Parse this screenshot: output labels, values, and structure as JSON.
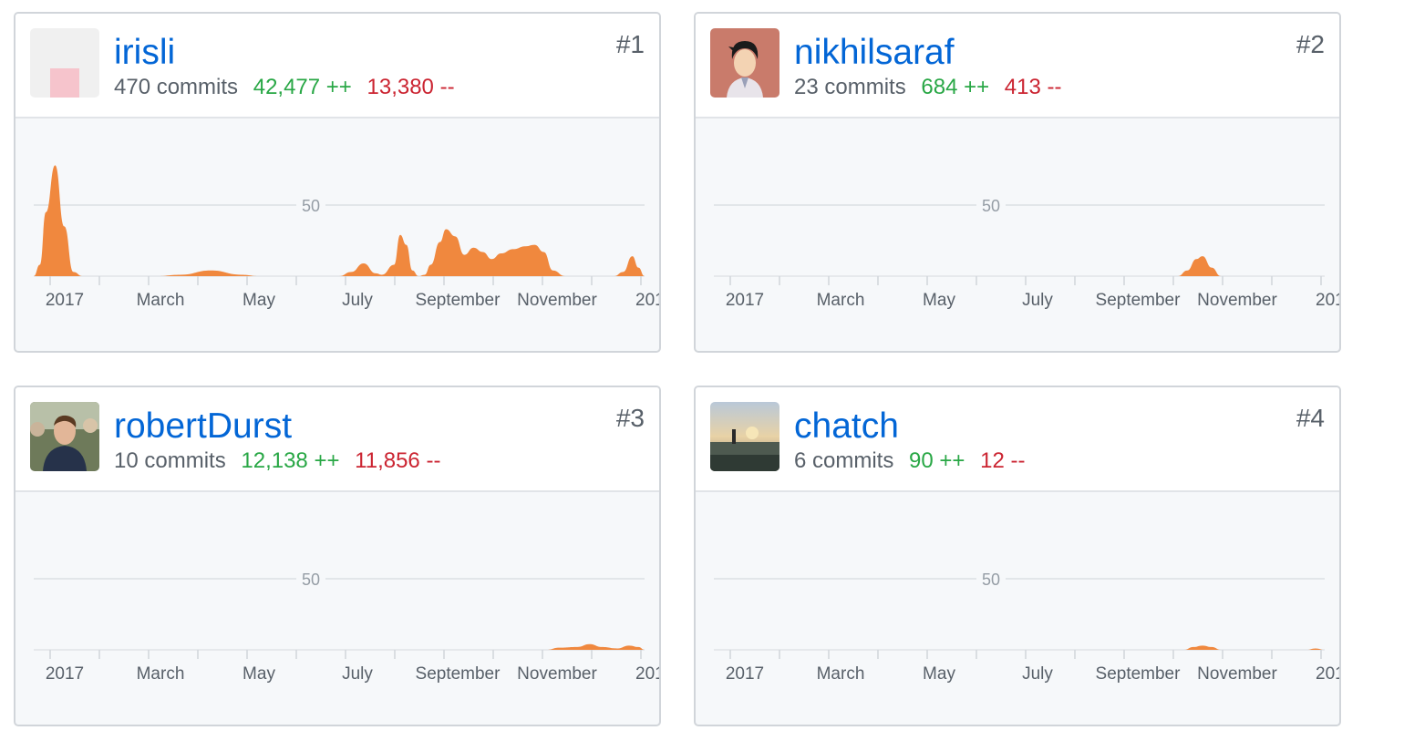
{
  "contributors": [
    {
      "rank": "#1",
      "username": "irisli",
      "commits": "470 commits",
      "additions": "42,477 ++",
      "deletions": "13,380 --",
      "avatar_icon": "identicon-avatar-icon"
    },
    {
      "rank": "#2",
      "username": "nikhilsaraf",
      "commits": "23 commits",
      "additions": "684 ++",
      "deletions": "413 --",
      "avatar_icon": "cartoon-person-avatar-icon"
    },
    {
      "rank": "#3",
      "username": "robertDurst",
      "commits": "10 commits",
      "additions": "12,138 ++",
      "deletions": "11,856 --",
      "avatar_icon": "photo-person-avatar-icon"
    },
    {
      "rank": "#4",
      "username": "chatch",
      "commits": "6 commits",
      "additions": "90 ++",
      "deletions": "12 --",
      "avatar_icon": "sunset-photo-avatar-icon"
    }
  ],
  "chart_data": [
    {
      "type": "area",
      "series_owner": "irisli",
      "x_tick_labels": [
        "2017",
        "March",
        "May",
        "July",
        "September",
        "November",
        "201"
      ],
      "y_gridline_label": "50",
      "ylim": [
        0,
        80
      ],
      "color": "#f0883e",
      "points": [
        [
          0,
          0
        ],
        [
          0.01,
          8
        ],
        [
          0.02,
          45
        ],
        [
          0.035,
          78
        ],
        [
          0.05,
          35
        ],
        [
          0.065,
          3
        ],
        [
          0.08,
          0
        ],
        [
          0.2,
          0
        ],
        [
          0.24,
          1
        ],
        [
          0.29,
          4
        ],
        [
          0.34,
          1
        ],
        [
          0.37,
          0
        ],
        [
          0.5,
          0
        ],
        [
          0.52,
          3
        ],
        [
          0.54,
          9
        ],
        [
          0.56,
          2
        ],
        [
          0.57,
          1
        ],
        [
          0.59,
          8
        ],
        [
          0.6,
          29
        ],
        [
          0.61,
          22
        ],
        [
          0.62,
          4
        ],
        [
          0.63,
          0
        ],
        [
          0.64,
          1
        ],
        [
          0.65,
          8
        ],
        [
          0.665,
          24
        ],
        [
          0.675,
          33
        ],
        [
          0.69,
          28
        ],
        [
          0.705,
          15
        ],
        [
          0.72,
          20
        ],
        [
          0.735,
          17
        ],
        [
          0.75,
          12
        ],
        [
          0.765,
          16
        ],
        [
          0.785,
          19
        ],
        [
          0.805,
          21
        ],
        [
          0.82,
          22
        ],
        [
          0.835,
          17
        ],
        [
          0.85,
          4
        ],
        [
          0.87,
          0
        ],
        [
          0.95,
          0
        ],
        [
          0.965,
          3
        ],
        [
          0.98,
          14
        ],
        [
          0.99,
          6
        ],
        [
          1,
          0
        ]
      ]
    },
    {
      "type": "area",
      "series_owner": "nikhilsaraf",
      "x_tick_labels": [
        "2017",
        "March",
        "May",
        "July",
        "September",
        "November",
        "201"
      ],
      "y_gridline_label": "50",
      "ylim": [
        0,
        80
      ],
      "color": "#f0883e",
      "points": [
        [
          0,
          0
        ],
        [
          0.76,
          0
        ],
        [
          0.775,
          4
        ],
        [
          0.79,
          12
        ],
        [
          0.8,
          14
        ],
        [
          0.815,
          6
        ],
        [
          0.83,
          0
        ],
        [
          1,
          0
        ]
      ]
    },
    {
      "type": "area",
      "series_owner": "robertDurst",
      "x_tick_labels": [
        "2017",
        "March",
        "May",
        "July",
        "September",
        "November",
        "201"
      ],
      "y_gridline_label": "50",
      "ylim": [
        0,
        80
      ],
      "color": "#f0883e",
      "points": [
        [
          0,
          0
        ],
        [
          0.84,
          0
        ],
        [
          0.86,
          1.5
        ],
        [
          0.89,
          2
        ],
        [
          0.91,
          4
        ],
        [
          0.93,
          2
        ],
        [
          0.955,
          1
        ],
        [
          0.975,
          3
        ],
        [
          0.99,
          2
        ],
        [
          1,
          0
        ]
      ]
    },
    {
      "type": "area",
      "series_owner": "chatch",
      "x_tick_labels": [
        "2017",
        "March",
        "May",
        "July",
        "September",
        "November",
        "201"
      ],
      "y_gridline_label": "50",
      "ylim": [
        0,
        80
      ],
      "color": "#f0883e",
      "points": [
        [
          0,
          0
        ],
        [
          0.77,
          0
        ],
        [
          0.785,
          2
        ],
        [
          0.8,
          3
        ],
        [
          0.815,
          2
        ],
        [
          0.83,
          0
        ],
        [
          0.97,
          0
        ],
        [
          0.985,
          1
        ],
        [
          1,
          0
        ]
      ]
    }
  ]
}
